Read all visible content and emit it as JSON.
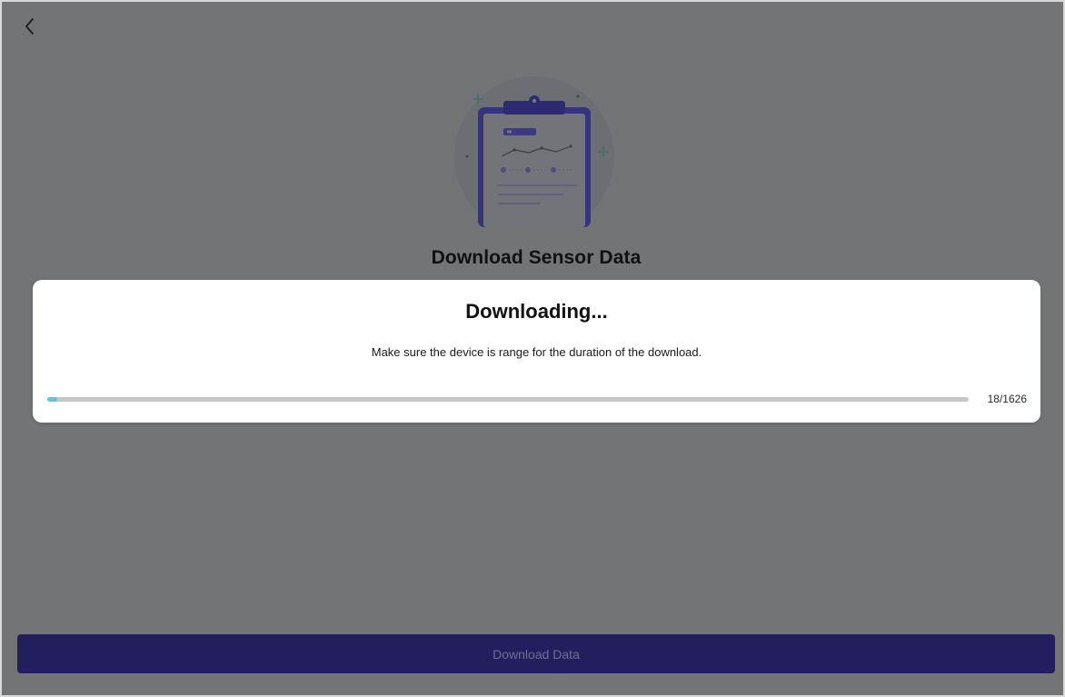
{
  "header": {
    "back_icon": "chevron-left-icon"
  },
  "illustration": {
    "icon": "clipboard-chart-icon"
  },
  "screen": {
    "title": "Download Sensor Data"
  },
  "modal": {
    "title": "Downloading...",
    "message": "Make sure the device is range for the duration of the download.",
    "progress": {
      "current": 18,
      "total": 1626,
      "label": "18/1626"
    }
  },
  "footer": {
    "download_button_label": "Download Data"
  },
  "colors": {
    "overlay_background": "#737476",
    "accent": "#231f5f",
    "progress_fill": "#5fc6df",
    "progress_track": "#c6c6c6",
    "modal_background": "#ffffff"
  }
}
